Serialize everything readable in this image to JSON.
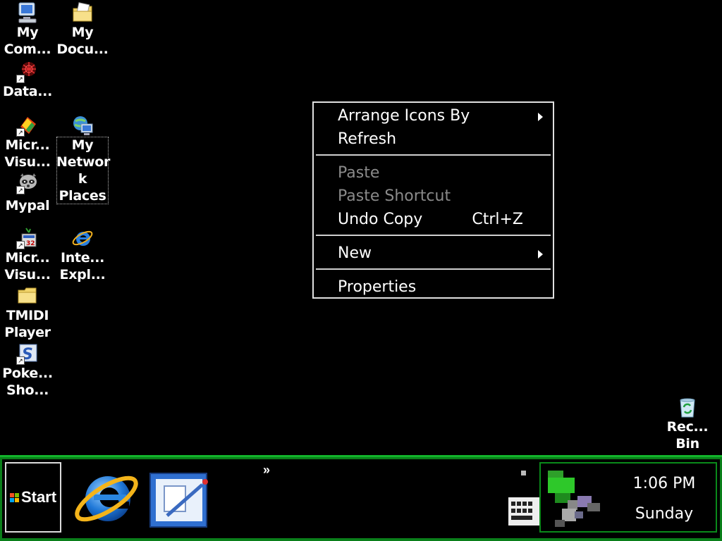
{
  "desktop": {
    "icons": [
      {
        "label": "My\nCom..."
      },
      {
        "label": "My\nDocu..."
      },
      {
        "label": "Data..."
      },
      {
        "label": "Micr...\nVisu..."
      },
      {
        "label": "My\nNetwor\nk\nPlaces"
      },
      {
        "label": "Mypal"
      },
      {
        "label": "Micr...\nVisu..."
      },
      {
        "label": "Inte...\nExpl..."
      },
      {
        "label": "TMIDI\nPlayer"
      },
      {
        "label": "Poke...\nSho..."
      },
      {
        "label": "Rec...\nBin"
      }
    ]
  },
  "context_menu": {
    "items": [
      {
        "label": "Arrange Icons By",
        "submenu": true,
        "enabled": true
      },
      {
        "label": "Refresh",
        "enabled": true
      },
      {
        "label": "Paste",
        "enabled": false
      },
      {
        "label": "Paste Shortcut",
        "enabled": false
      },
      {
        "label": "Undo Copy",
        "accelerator": "Ctrl+Z",
        "enabled": true
      },
      {
        "label": "New",
        "submenu": true,
        "enabled": true
      },
      {
        "label": "Properties",
        "enabled": true
      }
    ]
  },
  "taskbar": {
    "start_label": "Start",
    "chevron": "»",
    "quick_launch": [
      {
        "icon": "internet-explorer-icon"
      },
      {
        "icon": "outlook-express-icon"
      }
    ],
    "tray": {
      "time": "1:06 PM",
      "day": "Sunday"
    }
  },
  "colors": {
    "taskbar_green": "#0a7f1a",
    "menu_border": "#e0e0e0",
    "disabled_text": "#8a8a8a"
  }
}
